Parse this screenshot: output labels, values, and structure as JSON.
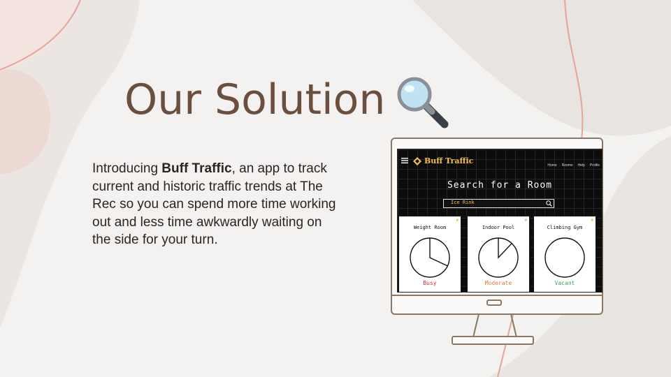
{
  "slide": {
    "title": "Our Solution",
    "intro": {
      "prefix": "Introducing ",
      "highlight": "Buff Traffic",
      "suffix": ", an app to track current and historic traffic trends at The Rec so you can spend more time working out and less time awkwardly waiting on the side for your turn."
    }
  },
  "app": {
    "brand": "Buff Traffic",
    "nav": [
      "Home",
      "Rooms",
      "Help",
      "Profile"
    ],
    "search_title": "Search for a Room",
    "search_value": "Ice Rink",
    "cards": [
      {
        "name": "Weight Room",
        "status": "Busy",
        "status_color": "#c9302c",
        "fill": 0.32
      },
      {
        "name": "Indoor Pool",
        "status": "Moderate",
        "status_color": "#e07b39",
        "fill": 0.12
      },
      {
        "name": "Climbing Gym",
        "status": "Vacant",
        "status_color": "#3aa655",
        "fill": 0.0
      }
    ]
  },
  "colors": {
    "title": "#6a4f3e",
    "accent_line": "#e3a49a",
    "brand": "#f0c24d"
  },
  "icons": [
    "magnifier-icon",
    "hamburger-icon",
    "logo-icon",
    "search-icon",
    "star-icon"
  ]
}
